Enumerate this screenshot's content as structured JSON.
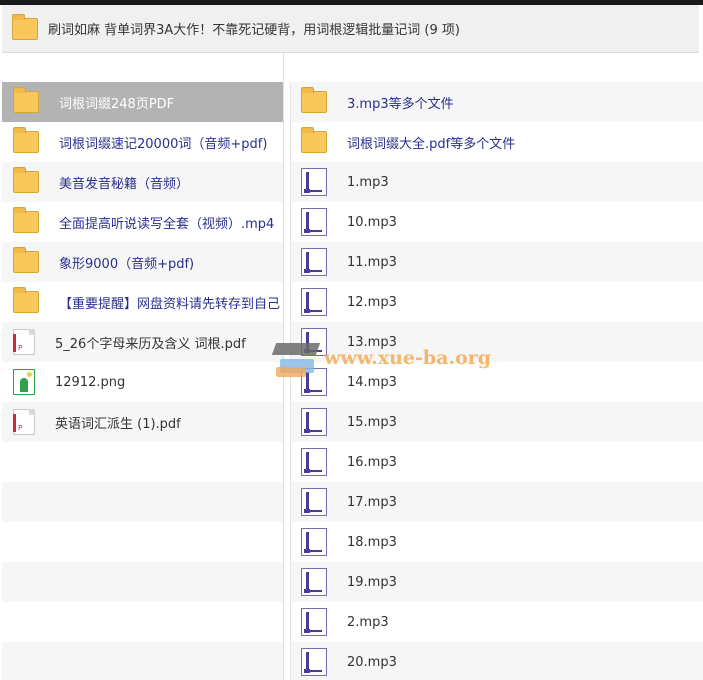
{
  "window": {
    "title": "刷词如麻 背单词界3A大作！不靠死记硬背，用词根逻辑批量记词 (9 项)"
  },
  "left_items": [
    {
      "type": "folder",
      "name": "词根词缀248页PDF",
      "selected": true
    },
    {
      "type": "folder",
      "name": "词根词缀速记20000词（音频+pdf)"
    },
    {
      "type": "folder",
      "name": "美音发音秘籍（音频）"
    },
    {
      "type": "folder",
      "name": "全面提高听说读写全套（视频）.mp4"
    },
    {
      "type": "folder",
      "name": "象形9000（音频+pdf)"
    },
    {
      "type": "folder",
      "name": "【重要提醒】网盘资料请先转存到自己"
    },
    {
      "type": "pdf",
      "name": "5_26个字母来历及含义 词根.pdf"
    },
    {
      "type": "png",
      "name": "12912.png"
    },
    {
      "type": "pdf",
      "name": "英语词汇派生 (1).pdf"
    },
    {
      "type": "empty",
      "name": ""
    },
    {
      "type": "empty",
      "name": ""
    },
    {
      "type": "empty",
      "name": ""
    },
    {
      "type": "empty",
      "name": ""
    },
    {
      "type": "empty",
      "name": ""
    },
    {
      "type": "empty",
      "name": ""
    }
  ],
  "right_items": [
    {
      "type": "folder",
      "name": "3.mp3等多个文件"
    },
    {
      "type": "folder",
      "name": "词根词缀大全.pdf等多个文件"
    },
    {
      "type": "mp3",
      "name": "1.mp3"
    },
    {
      "type": "mp3",
      "name": "10.mp3"
    },
    {
      "type": "mp3",
      "name": "11.mp3"
    },
    {
      "type": "mp3",
      "name": "12.mp3"
    },
    {
      "type": "mp3",
      "name": "13.mp3"
    },
    {
      "type": "mp3",
      "name": "14.mp3"
    },
    {
      "type": "mp3",
      "name": "15.mp3"
    },
    {
      "type": "mp3",
      "name": "16.mp3"
    },
    {
      "type": "mp3",
      "name": "17.mp3"
    },
    {
      "type": "mp3",
      "name": "18.mp3"
    },
    {
      "type": "mp3",
      "name": "19.mp3"
    },
    {
      "type": "mp3",
      "name": "2.mp3"
    },
    {
      "type": "mp3",
      "name": "20.mp3"
    }
  ],
  "watermark": {
    "text": "www.xue-ba.org"
  },
  "colors": {
    "folder_link": "#2a2f8f",
    "selected_row": "#b3b3b3",
    "folder_icon": "#f8c85a",
    "mp3_icon": "#4b3b93",
    "pdf_icon": "#d0283a",
    "png_icon": "#2fa24a",
    "watermark": "#f4a03c"
  }
}
